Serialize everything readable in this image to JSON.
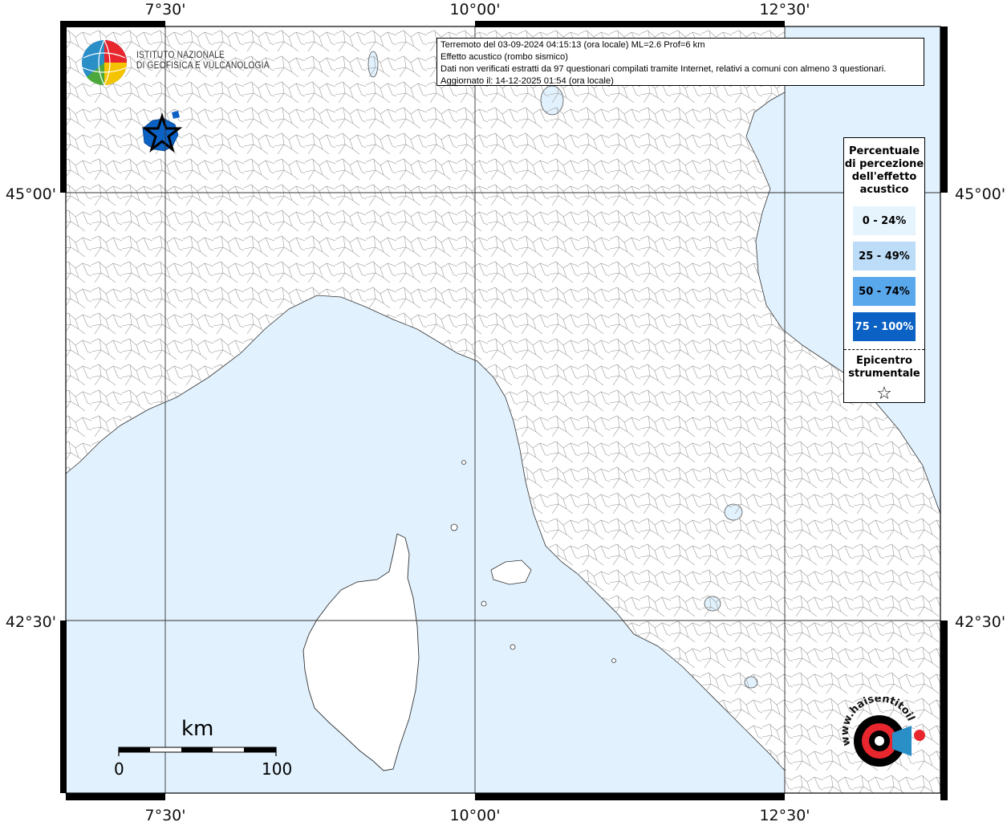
{
  "map": {
    "top_ticks": [
      "7°30'",
      "10°00'",
      "12°30'"
    ],
    "bottom_ticks": [
      "7°30'",
      "10°00'",
      "12°30'"
    ],
    "left_ticks": [
      "45°00'",
      "42°30'"
    ],
    "right_ticks": [
      "45°00'",
      "42°30'"
    ]
  },
  "info": {
    "line1": "Terremoto del 03-09-2024 04:15:13 (ora locale) ML=2.6 Prof=6 km",
    "line2": "Effetto acustico (rombo sismico)",
    "line3": "Dati non verificati estratti da 97 questionari compilati tramite Internet, relativi a comuni con almeno 3 questionari.",
    "line4": "Aggiornato il: 14-12-2025 01:54 (ora locale)"
  },
  "legend": {
    "title": "Percentuale di percezione dell'effetto acustico",
    "classes": [
      {
        "label": "0 - 24%",
        "color": "#e6f4fe",
        "text_color": "#000000"
      },
      {
        "label": "25 - 49%",
        "color": "#bcdcf7",
        "text_color": "#000000"
      },
      {
        "label": "50 - 74%",
        "color": "#5aa8ec",
        "text_color": "#000000"
      },
      {
        "label": "75 - 100%",
        "color": "#0b62c4",
        "text_color": "#ffffff"
      }
    ],
    "epicenter_label": "Epicentro strumentale",
    "epicenter_symbol": "☆"
  },
  "logos": {
    "ingv_line1": "ISTITUTO NAZIONALE",
    "ingv_line2": "DI GEOFISICA E VULCANOLOGIA",
    "sentito_text": "www.haisentitoilterremoto.it"
  },
  "scale_bar": {
    "unit": "km",
    "start": "0",
    "end": "100"
  },
  "colors": {
    "sea": "#e1f1fd",
    "land": "#ffffff",
    "border": "#8a8a8a",
    "felt_area": "#0b62c4"
  }
}
